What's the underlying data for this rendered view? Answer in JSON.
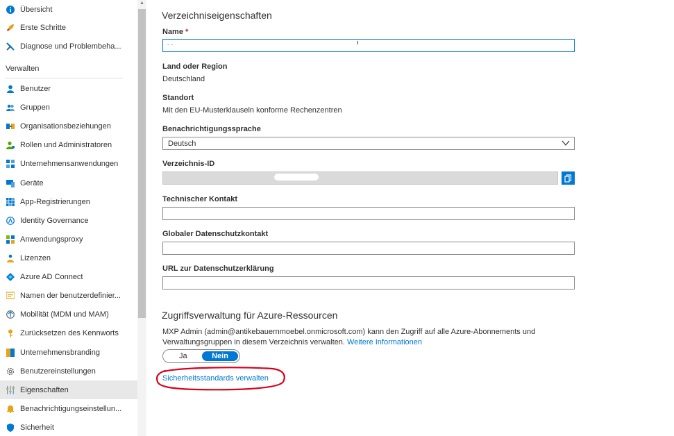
{
  "sidebar": {
    "items": [
      {
        "label": "Übersicht",
        "icon": "info-icon"
      },
      {
        "label": "Erste Schritte",
        "icon": "rocket-icon"
      },
      {
        "label": "Diagnose und Problembeha...",
        "icon": "wrench-icon"
      }
    ],
    "section_title": "Verwalten",
    "manage_items": [
      {
        "label": "Benutzer",
        "icon": "user-icon"
      },
      {
        "label": "Gruppen",
        "icon": "group-icon"
      },
      {
        "label": "Organisationsbeziehungen",
        "icon": "org-relations-icon"
      },
      {
        "label": "Rollen und Administratoren",
        "icon": "roles-icon"
      },
      {
        "label": "Unternehmensanwendungen",
        "icon": "enterprise-apps-icon"
      },
      {
        "label": "Geräte",
        "icon": "devices-icon"
      },
      {
        "label": "App-Registrierungen",
        "icon": "app-registrations-icon"
      },
      {
        "label": "Identity Governance",
        "icon": "identity-governance-icon"
      },
      {
        "label": "Anwendungsproxy",
        "icon": "app-proxy-icon"
      },
      {
        "label": "Lizenzen",
        "icon": "licenses-icon"
      },
      {
        "label": "Azure AD Connect",
        "icon": "ad-connect-icon"
      },
      {
        "label": "Namen der benutzerdefinier...",
        "icon": "custom-domain-icon"
      },
      {
        "label": "Mobilität (MDM und MAM)",
        "icon": "mobility-icon"
      },
      {
        "label": "Zurücksetzen des Kennworts",
        "icon": "key-icon"
      },
      {
        "label": "Unternehmensbranding",
        "icon": "branding-icon"
      },
      {
        "label": "Benutzereinstellungen",
        "icon": "gear-icon"
      },
      {
        "label": "Eigenschaften",
        "icon": "properties-icon",
        "active": true
      },
      {
        "label": "Benachrichtigungseinstellun...",
        "icon": "bell-icon"
      },
      {
        "label": "Sicherheit",
        "icon": "shield-icon"
      }
    ]
  },
  "main": {
    "section1_title": "Verzeichniseigenschaften",
    "name_label": "Name",
    "name_required": "*",
    "name_value": "- -",
    "country_label": "Land oder Region",
    "country_value": "Deutschland",
    "location_label": "Standort",
    "location_value": "Mit den EU-Musterklauseln konforme Rechenzentren",
    "notify_lang_label": "Benachrichtigungssprache",
    "notify_lang_value": "Deutsch",
    "dir_id_label": "Verzeichnis-ID",
    "tech_contact_label": "Technischer Kontakt",
    "privacy_contact_label": "Globaler Datenschutzkontakt",
    "privacy_url_label": "URL zur Datenschutzerklärung",
    "section2_title": "Zugriffsverwaltung für Azure-Ressourcen",
    "access_text": "MXP Admin (admin@antikebauernmoebel.onmicrosoft.com) kann den Zugriff auf alle Azure-Abonnements und Verwaltungsgruppen in diesem Verzeichnis verwalten.",
    "more_info_link": "Weitere Informationen",
    "toggle_yes": "Ja",
    "toggle_no": "Nein",
    "toggle_selected": "Nein",
    "security_defaults_link": "Sicherheitsstandards verwalten"
  },
  "colors": {
    "accent": "#0078d4",
    "annotation": "#d9001b",
    "required": "#a4262c"
  }
}
